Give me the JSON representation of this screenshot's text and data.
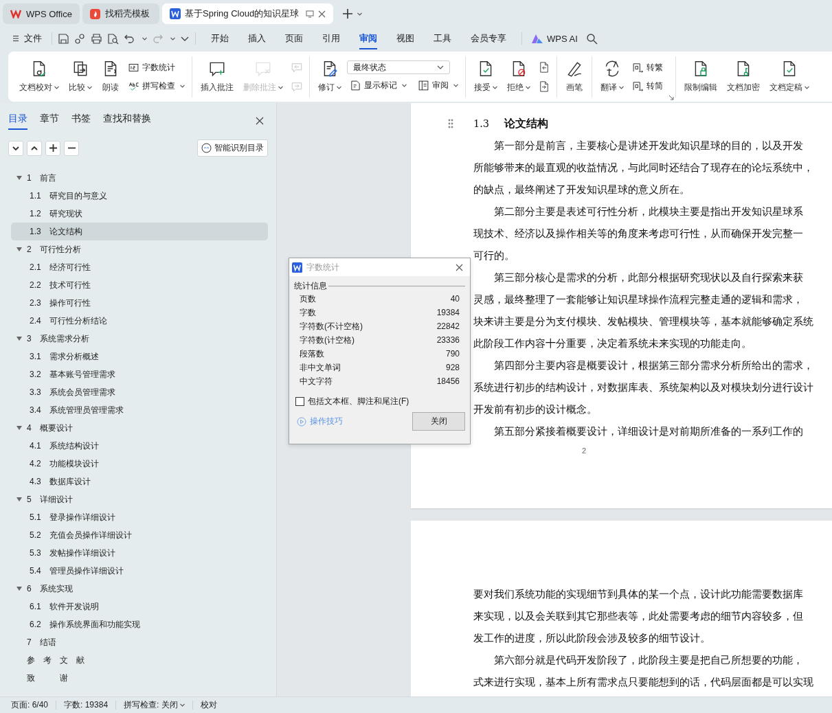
{
  "browser_tabs": [
    {
      "label": "WPS Office",
      "selected": false
    },
    {
      "label": "找稻壳模板",
      "selected": false
    },
    {
      "label": "基于Spring Cloud的知识星球",
      "selected": true
    }
  ],
  "menu": {
    "file": "文件",
    "tabs": [
      {
        "label": "开始",
        "selected": false
      },
      {
        "label": "插入",
        "selected": false
      },
      {
        "label": "页面",
        "selected": false
      },
      {
        "label": "引用",
        "selected": false
      },
      {
        "label": "审阅",
        "selected": true
      },
      {
        "label": "视图",
        "selected": false
      },
      {
        "label": "工具",
        "selected": false
      },
      {
        "label": "会员专享",
        "selected": false
      }
    ],
    "ai": "WPS AI"
  },
  "ribbon": {
    "groups": [
      {
        "items": [
          {
            "kind": "large",
            "label": "文档校对",
            "menu": true,
            "disabled": false
          },
          {
            "kind": "large",
            "label": "比较",
            "menu": true,
            "disabled": false
          },
          {
            "kind": "large",
            "label": "朗读",
            "menu": false,
            "disabled": false
          },
          {
            "kind": "stack",
            "items": [
              {
                "kind": "small",
                "label": "字数统计",
                "menu": false,
                "disabled": false
              },
              {
                "kind": "small",
                "label": "拼写检查",
                "menu": true,
                "disabled": false
              }
            ]
          }
        ]
      },
      {
        "items": [
          {
            "kind": "large",
            "label": "插入批注",
            "menu": false,
            "disabled": false
          },
          {
            "kind": "large",
            "label": "删除批注",
            "menu": true,
            "disabled": true
          },
          {
            "kind": "stack",
            "items": [
              {
                "kind": "icon",
                "disabled": true
              },
              {
                "kind": "icon",
                "disabled": true
              }
            ]
          }
        ]
      },
      {
        "items": [
          {
            "kind": "large",
            "label": "修订",
            "menu": true,
            "disabled": false
          },
          {
            "kind": "stack",
            "items": [
              {
                "kind": "select",
                "value": "最终状态"
              },
              {
                "kind": "pair",
                "items": [
                  {
                    "kind": "small",
                    "label": "显示标记",
                    "menu": true,
                    "disabled": false
                  },
                  {
                    "kind": "small",
                    "label": "审阅",
                    "menu": true,
                    "disabled": false
                  }
                ]
              }
            ]
          }
        ]
      },
      {
        "items": [
          {
            "kind": "large",
            "label": "接受",
            "menu": true,
            "disabled": false
          },
          {
            "kind": "large",
            "label": "拒绝",
            "menu": true,
            "disabled": false
          },
          {
            "kind": "stack",
            "items": [
              {
                "kind": "icon",
                "disabled": false
              },
              {
                "kind": "icon",
                "disabled": false
              }
            ]
          }
        ]
      },
      {
        "items": [
          {
            "kind": "large",
            "label": "画笔",
            "menu": false,
            "disabled": false
          }
        ]
      },
      {
        "items": [
          {
            "kind": "large",
            "label": "翻译",
            "menu": true,
            "disabled": false
          },
          {
            "kind": "stack",
            "items": [
              {
                "kind": "small",
                "label": "转繁",
                "menu": false,
                "disabled": false
              },
              {
                "kind": "small",
                "label": "转简",
                "menu": false,
                "disabled": false
              }
            ]
          },
          {
            "kind": "launcher"
          }
        ]
      },
      {
        "items": [
          {
            "kind": "large",
            "label": "限制编辑",
            "menu": false,
            "disabled": false
          },
          {
            "kind": "large",
            "label": "文档加密",
            "menu": false,
            "disabled": false
          },
          {
            "kind": "large",
            "label": "文档定稿",
            "menu": true,
            "disabled": false
          }
        ]
      }
    ]
  },
  "sidebar": {
    "tabs": [
      {
        "label": "目录",
        "selected": true
      },
      {
        "label": "章节",
        "selected": false
      },
      {
        "label": "书签",
        "selected": false
      },
      {
        "label": "查找和替换",
        "selected": false
      }
    ],
    "smart_button": "智能识别目录",
    "outline": [
      {
        "number": "1",
        "title": "前言",
        "selected": false,
        "expanded": true,
        "children": [
          {
            "number": "1.1",
            "title": "研究目的与意义",
            "selected": false
          },
          {
            "number": "1.2",
            "title": "研究现状",
            "selected": false
          },
          {
            "number": "1.3",
            "title": "论文结构",
            "selected": true
          }
        ]
      },
      {
        "number": "2",
        "title": "可行性分析",
        "selected": false,
        "expanded": true,
        "children": [
          {
            "number": "2.1",
            "title": "经济可行性",
            "selected": false
          },
          {
            "number": "2.2",
            "title": "技术可行性",
            "selected": false
          },
          {
            "number": "2.3",
            "title": "操作可行性",
            "selected": false
          },
          {
            "number": "2.4",
            "title": "可行性分析结论",
            "selected": false
          }
        ]
      },
      {
        "number": "3",
        "title": "系统需求分析",
        "selected": false,
        "expanded": true,
        "children": [
          {
            "number": "3.1",
            "title": "需求分析概述",
            "selected": false
          },
          {
            "number": "3.2",
            "title": "基本账号管理需求",
            "selected": false
          },
          {
            "number": "3.3",
            "title": "系统会员管理需求",
            "selected": false
          },
          {
            "number": "3.4",
            "title": "系统管理员管理需求",
            "selected": false
          }
        ]
      },
      {
        "number": "4",
        "title": "概要设计",
        "selected": false,
        "expanded": true,
        "children": [
          {
            "number": "4.1",
            "title": "系统结构设计",
            "selected": false
          },
          {
            "number": "4.2",
            "title": "功能模块设计",
            "selected": false
          },
          {
            "number": "4.3",
            "title": "数据库设计",
            "selected": false
          }
        ]
      },
      {
        "number": "5",
        "title": "详细设计",
        "selected": false,
        "expanded": true,
        "children": [
          {
            "number": "5.1",
            "title": "登录操作详细设计",
            "selected": false
          },
          {
            "number": "5.2",
            "title": "充值会员操作详细设计",
            "selected": false
          },
          {
            "number": "5.3",
            "title": "发帖操作详细设计",
            "selected": false
          },
          {
            "number": "5.4",
            "title": "管理员操作详细设计",
            "selected": false
          }
        ]
      },
      {
        "number": "6",
        "title": "系统实现",
        "selected": false,
        "expanded": true,
        "children": [
          {
            "number": "6.1",
            "title": "软件开发说明",
            "selected": false
          },
          {
            "number": "6.2",
            "title": "操作系统界面和功能实现",
            "selected": false
          }
        ]
      },
      {
        "number": "7",
        "title": "结语",
        "selected": false
      },
      {
        "title": "参　考　文　献",
        "selected": false
      },
      {
        "title": "致　　　谢",
        "selected": false
      }
    ]
  },
  "document": {
    "heading": {
      "number": "1.3",
      "title": "论文结构"
    },
    "page1_lines": [
      {
        "text": "第一部分是前言，主要核心是讲述开发此知识星球的目的，以及开发",
        "indent": true
      },
      {
        "text": "所能够带来的最直观的收益情况，与此同时还结合了现存在的论坛系统中，",
        "indent": false
      },
      {
        "text": "的缺点，最终阐述了开发知识星球的意义所在。",
        "indent": false
      },
      {
        "text": "第二部分主要是表述可行性分析，此模块主要是指出开发知识星球系",
        "indent": true
      },
      {
        "text": "现技术、经济以及操作相关等的角度来考虑可行性，从而确保开发完整一",
        "indent": false
      },
      {
        "text": "可行的。",
        "indent": false
      },
      {
        "text": "第三部分核心是需求的分析，此部分根据研究现状以及自行探索来获",
        "indent": true
      },
      {
        "text": "灵感，最终整理了一套能够让知识星球操作流程完整走通的逻辑和需求，",
        "indent": false
      },
      {
        "text": "块来讲主要是分为支付模块、发帖模块、管理模块等，基本就能够确定系统",
        "indent": false
      },
      {
        "text": "此阶段工作内容十分重要，决定着系统未来实现的功能走向。",
        "indent": false
      },
      {
        "text": "第四部分主要内容是概要设计，根据第三部分需求分析所给出的需求，",
        "indent": true
      },
      {
        "text": "系统进行初步的结构设计，对数据库表、系统架构以及对模块划分进行设计",
        "indent": false
      },
      {
        "text": "开发前有初步的设计概念。",
        "indent": false
      },
      {
        "text": "第五部分紧接着概要设计，详细设计是对前期所准备的一系列工作的",
        "indent": true
      }
    ],
    "page_number": "2",
    "page2_lines": [
      {
        "text": "要对我们系统功能的实现细节到具体的某一个点，设计此功能需要数据库",
        "indent": false
      },
      {
        "text": "来实现，以及会关联到其它那些表等，此处需要考虑的细节内容较多，但",
        "indent": false
      },
      {
        "text": "发工作的进度，所以此阶段会涉及较多的细节设计。",
        "indent": false
      },
      {
        "text": "第六部分就是代码开发阶段了，此阶段主要是把自己所想要的功能，",
        "indent": true
      },
      {
        "text": "式来进行实现，基本上所有需求点只要能想到的话，代码层面都是可以实现",
        "indent": false
      }
    ]
  },
  "dialog": {
    "title": "字数统计",
    "section": "统计信息",
    "rows": [
      {
        "label": "页数",
        "value": "40"
      },
      {
        "label": "字数",
        "value": "19384"
      },
      {
        "label": "字符数(不计空格)",
        "value": "22842"
      },
      {
        "label": "字符数(计空格)",
        "value": "23336"
      },
      {
        "label": "段落数",
        "value": "790"
      },
      {
        "label": "非中文单词",
        "value": "928"
      },
      {
        "label": "中文字符",
        "value": "18456"
      }
    ],
    "checkbox": {
      "label": "包括文本框、脚注和尾注(F)",
      "checked": false
    },
    "tips_link": "操作技巧",
    "close_button": "关闭"
  },
  "status_bar": {
    "page": "页面: 6/40",
    "words": "字数: 19384",
    "spellcheck": "拼写检查: 关闭",
    "proofread": "校对"
  }
}
